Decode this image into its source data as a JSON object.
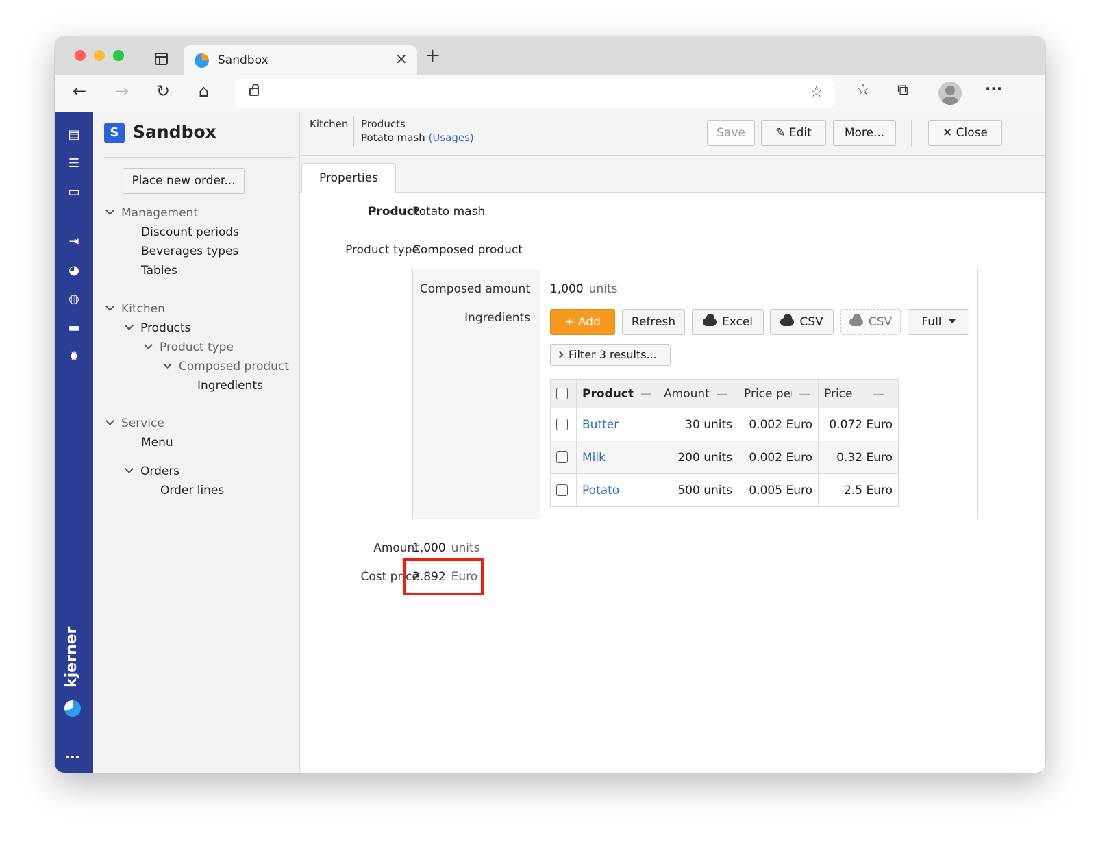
{
  "browser": {
    "tab_title": "Sandbox",
    "tab_close": "×",
    "new_tab": "+",
    "back": "←",
    "forward": "→",
    "reload": "↻",
    "home": "⌂",
    "favorite_add": "☆",
    "favorites": "☆",
    "collections": "⧉",
    "more": "···"
  },
  "rail": {
    "icons": [
      "document-icon",
      "list-check-icon",
      "window-icon",
      "login-icon",
      "palette-icon",
      "globe-icon",
      "card-icon",
      "gear-icon"
    ],
    "logo_text": "kjerner"
  },
  "sidebar": {
    "app_name": "Sandbox",
    "app_badge": "S",
    "place_order": "Place new order...",
    "nav": {
      "management": "Management",
      "discount_periods": "Discount periods",
      "beverages_types": "Beverages types",
      "tables": "Tables",
      "kitchen": "Kitchen",
      "products": "Products",
      "product_type": "Product type",
      "composed_product": "Composed product",
      "ingredients": "Ingredients",
      "service": "Service",
      "menu": "Menu",
      "orders": "Orders",
      "order_lines": "Order lines"
    }
  },
  "header": {
    "breadcrumb_root": "Kitchen",
    "breadcrumb_section": "Products",
    "breadcrumb_item": "Potato mash",
    "usages_link": "(Usages)",
    "save": "Save",
    "edit": "Edit",
    "more": "More...",
    "close": "Close"
  },
  "tabs": {
    "properties": "Properties"
  },
  "form": {
    "product_label": "Product",
    "product_value": "Potato mash",
    "product_type_label": "Product type",
    "product_type_value": "Composed product",
    "composed_amount_label": "Composed amount",
    "composed_amount_value": "1,000",
    "composed_amount_unit": "units",
    "ingredients_label": "Ingredients",
    "amount_label": "Amount",
    "amount_value": "1,000",
    "amount_unit": "units",
    "cost_price_label": "Cost price",
    "cost_price_value": "2.892",
    "cost_price_unit": "Euro"
  },
  "grid_toolbar": {
    "add": "Add",
    "refresh": "Refresh",
    "excel": "Excel",
    "csv": "CSV",
    "csv_dashed": "CSV",
    "full": "Full",
    "filter": "Filter 3 results..."
  },
  "ingredients_table": {
    "columns": [
      "Product",
      "Amount",
      "Price per unit",
      "Price"
    ],
    "rows": [
      {
        "product": "Butter",
        "amount": "30 units",
        "price_per_unit": "0.002 Euro",
        "price": "0.072 Euro"
      },
      {
        "product": "Milk",
        "amount": "200 units",
        "price_per_unit": "0.002 Euro",
        "price": "0.32 Euro"
      },
      {
        "product": "Potato",
        "amount": "500 units",
        "price_per_unit": "0.005 Euro",
        "price": "2.5 Euro"
      }
    ]
  }
}
